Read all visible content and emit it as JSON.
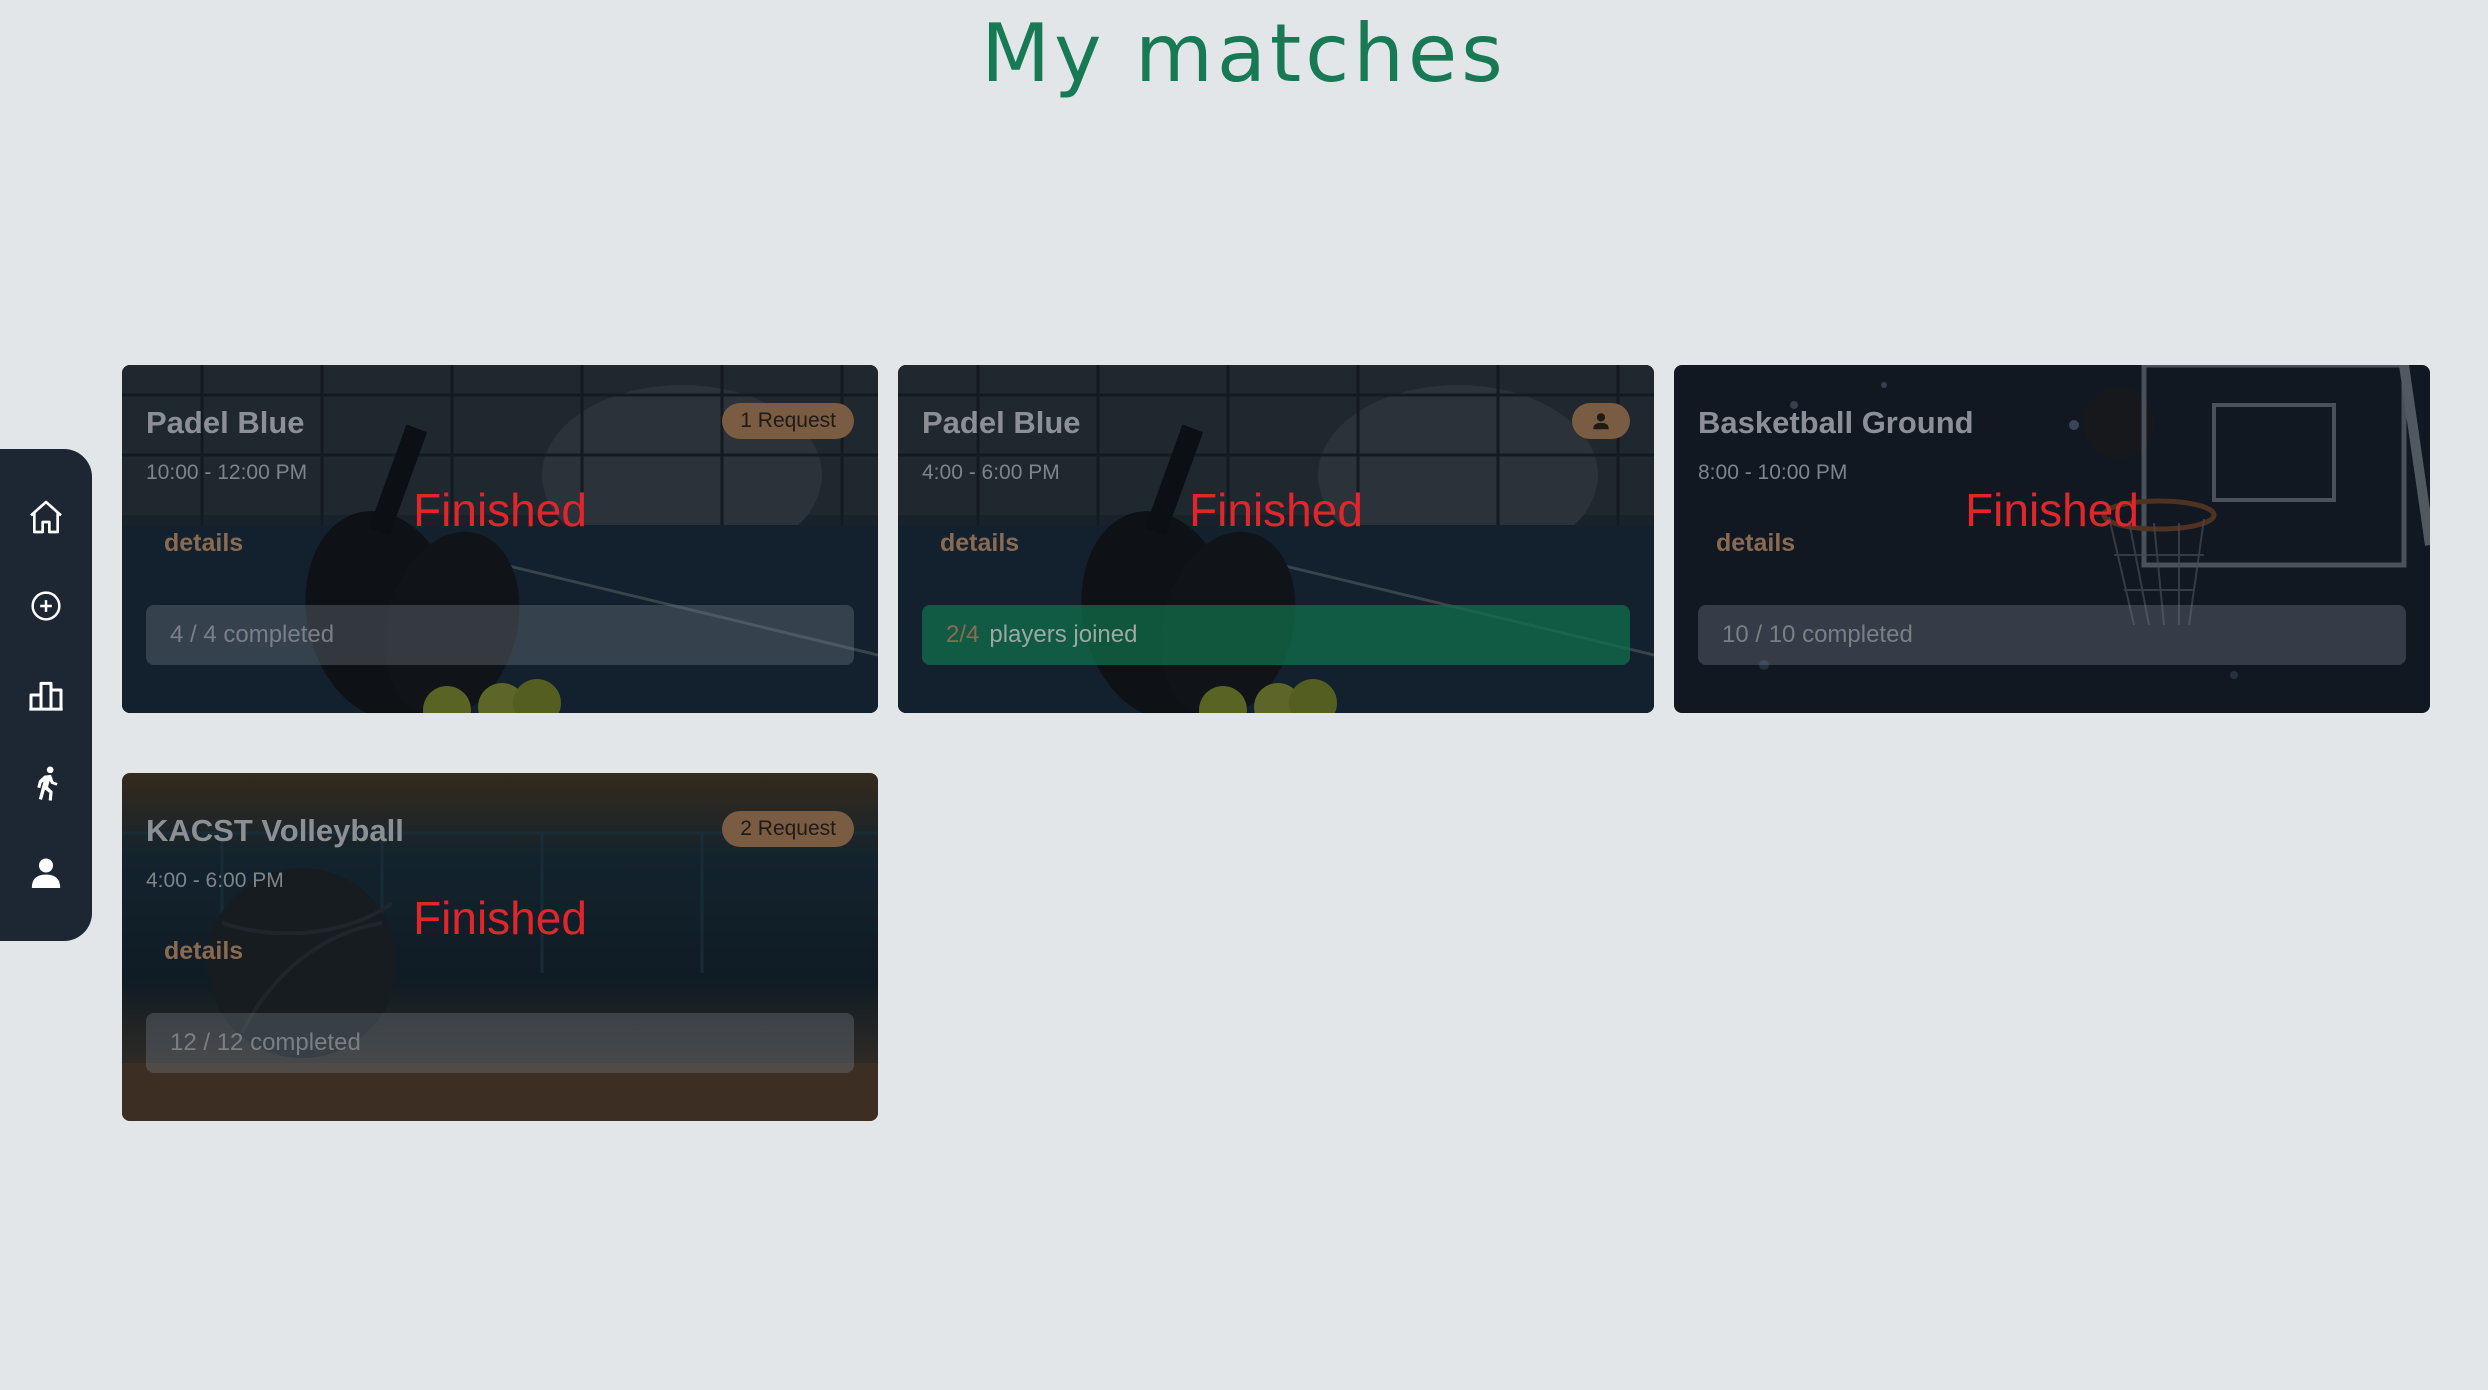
{
  "page": {
    "title": "My matches"
  },
  "sidebar": {
    "items": [
      {
        "name": "home",
        "icon": "home-icon"
      },
      {
        "name": "create-match",
        "icon": "plus-circle-icon"
      },
      {
        "name": "leaderboard",
        "icon": "podium-icon"
      },
      {
        "name": "my-matches",
        "icon": "runner-icon"
      },
      {
        "name": "profile",
        "icon": "user-icon"
      }
    ]
  },
  "matches": [
    {
      "title": "Padel Blue",
      "time": "10:00 - 12:00 PM",
      "status": "Finished",
      "details_label": "details",
      "badge": "1 Request",
      "progress_text": "4 / 4 completed",
      "background": "padel"
    },
    {
      "title": "Padel Blue",
      "time": "4:00 - 6:00 PM",
      "status": "Finished",
      "details_label": "details",
      "badge_icon": "user-group-icon",
      "progress_count": "2/4",
      "progress_text": "players joined",
      "background": "padel"
    },
    {
      "title": "Basketball Ground",
      "time": "8:00 - 10:00 PM",
      "status": "Finished",
      "details_label": "details",
      "progress_text": "10 / 10 completed",
      "background": "basketball"
    },
    {
      "title": "KACST Volleyball",
      "time": "4:00 - 6:00 PM",
      "status": "Finished",
      "details_label": "details",
      "badge": "2 Request",
      "progress_text": "12 / 12 completed",
      "background": "volleyball"
    }
  ],
  "colors": {
    "page_background": "#e3e6e8",
    "title": "#177a55",
    "sidebar": "#1d2733",
    "status_finished": "#e0262b",
    "badge": "#7a5c42",
    "joined_bar": "#126e4b"
  }
}
